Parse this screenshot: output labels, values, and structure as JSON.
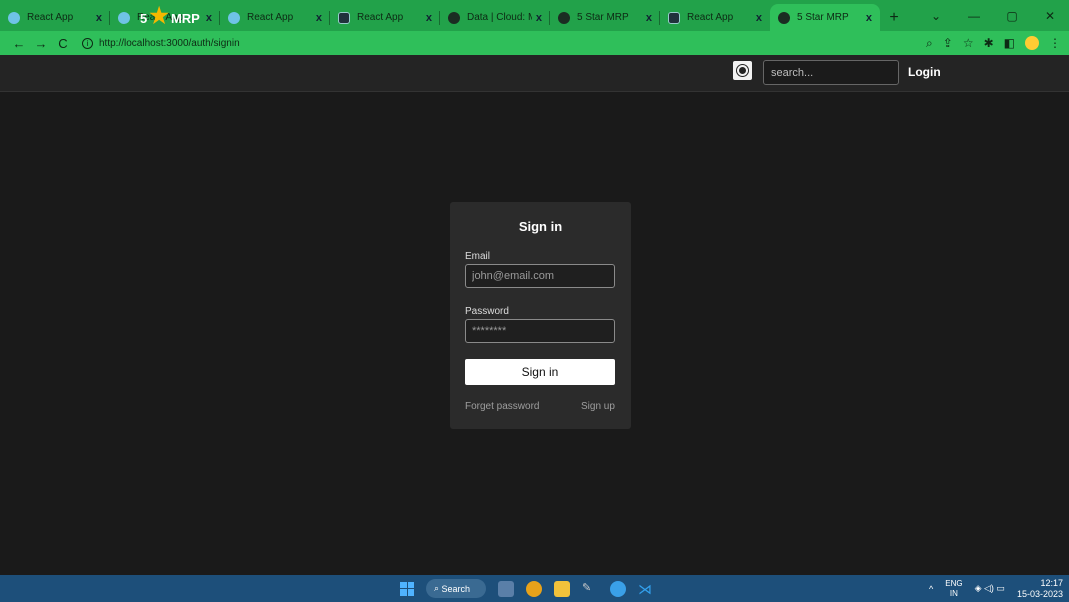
{
  "browser": {
    "tabs": [
      {
        "title": "React App",
        "favicon": "react-icon",
        "active": false
      },
      {
        "title": "React App",
        "favicon": "react-icon",
        "active": false
      },
      {
        "title": "React App",
        "favicon": "react-icon",
        "active": false
      },
      {
        "title": "React App",
        "favicon": "react-icon",
        "active": false
      },
      {
        "title": "Data | Cloud: Mo",
        "favicon": "mongodb-icon",
        "active": false
      },
      {
        "title": "5 Star MRP",
        "favicon": "app-icon",
        "active": false
      },
      {
        "title": "React App",
        "favicon": "react-icon",
        "active": false
      },
      {
        "title": "5 Star MRP",
        "favicon": "app-icon",
        "active": true
      }
    ],
    "new_tab_symbol": "+",
    "close_symbol": "x",
    "window_controls": [
      "⌄",
      "—",
      "▢",
      "✕"
    ],
    "url": "http://localhost:3000/auth/signin",
    "nav_back": "←",
    "nav_forward": "→",
    "nav_reload": "C",
    "accent_color": "#2fbf5a"
  },
  "header": {
    "logo_left": "5",
    "logo_star": "★",
    "logo_right": "MRP",
    "search_placeholder": "search...",
    "login_label": "Login"
  },
  "signin": {
    "title": "Sign in",
    "email_label": "Email",
    "email_placeholder": "john@email.com",
    "password_label": "Password",
    "password_placeholder": "********",
    "submit_label": "Sign in",
    "forgot_label": "Forget password",
    "signup_label": "Sign up"
  },
  "taskbar": {
    "search_label": "Search",
    "lang_top": "ENG",
    "lang_bottom": "IN",
    "time": "12:17",
    "date": "15-03-2023",
    "tray_chevron": "^",
    "tray_status": "◈ ◁) ▭"
  }
}
